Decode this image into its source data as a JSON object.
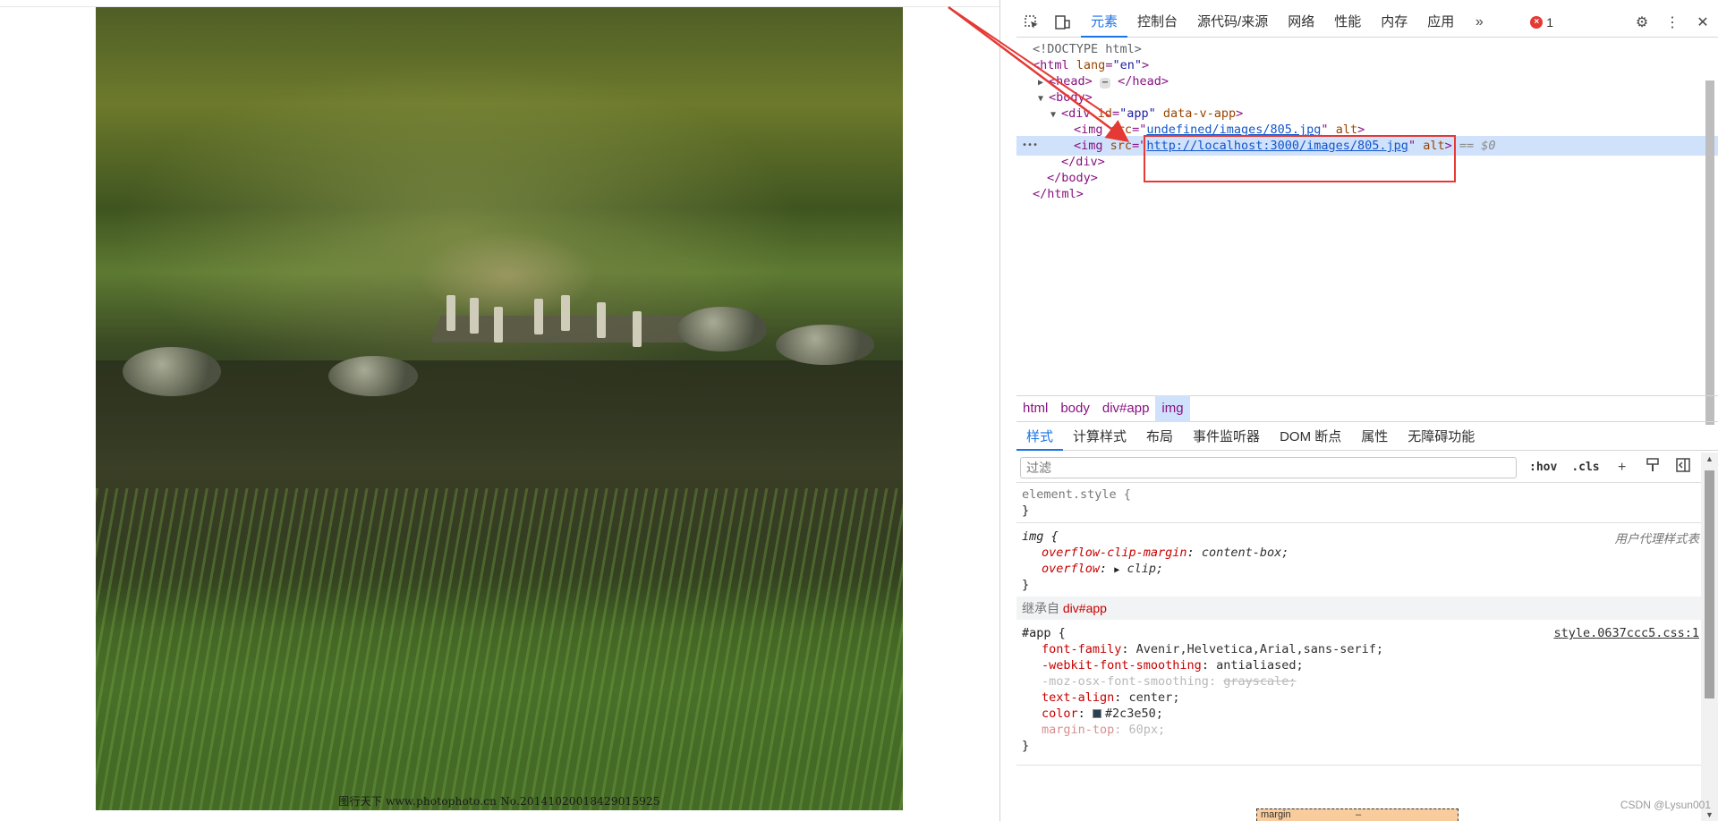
{
  "page": {
    "watermark": "图行天下 www.photophoto.cn No.20141020018429015925"
  },
  "devtools": {
    "tabs": [
      "元素",
      "控制台",
      "源代码/来源",
      "网络",
      "性能",
      "内存",
      "应用"
    ],
    "active_tab": "元素",
    "more_tabs_icon": "chevron-double-right-icon",
    "error_count": "1",
    "dom": {
      "doctype": "<!DOCTYPE html>",
      "html_open_tag": "html",
      "html_lang_attr": "lang",
      "html_lang_val": "\"en\"",
      "head_tag": "head",
      "head_close": "</head>",
      "body_tag": "body",
      "div_tag": "div",
      "div_id_attr": "id",
      "div_id_val": "\"app\"",
      "div_extra_attr": "data-v-app",
      "img1_tag": "img",
      "img1_src_attr": "src",
      "img1_src_val": "undefined/images/805.jpg",
      "img1_alt": "alt",
      "img2_tag": "img",
      "img2_src_attr": "src",
      "img2_src_val": "http://localhost:3000/images/805.jpg",
      "img2_alt": "alt",
      "selected_marker": "== $0",
      "div_close": "</div>",
      "body_close": "</body>",
      "html_close": "</html>",
      "gutter_dots": "•••"
    },
    "breadcrumbs": [
      "html",
      "body",
      "div#app",
      "img"
    ],
    "subtabs": [
      "样式",
      "计算样式",
      "布局",
      "事件监听器",
      "DOM 断点",
      "属性",
      "无障碍功能"
    ],
    "active_subtab": "样式",
    "filter": {
      "placeholder": "过滤",
      "hov_label": ":hov",
      "cls_label": ".cls"
    },
    "styles": {
      "element_style_selector": "element.style {",
      "close_brace": "}",
      "img_selector": "img {",
      "ua_label": "用户代理样式表",
      "img_props": [
        {
          "name": "overflow-clip-margin",
          "value": "content-box;"
        },
        {
          "name": "overflow",
          "value": "clip;"
        }
      ],
      "inherit_label": "继承自",
      "inherit_target": "div#app",
      "app_selector": "#app {",
      "app_source": "style.0637ccc5.css:1",
      "app_props": [
        {
          "name": "font-family",
          "value": "Avenir,Helvetica,Arial,sans-serif;"
        },
        {
          "name": "-webkit-font-smoothing",
          "value": "antialiased;"
        },
        {
          "name": "-moz-osx-font-smoothing",
          "value": "grayscale;"
        },
        {
          "name": "text-align",
          "value": "center;"
        },
        {
          "name": "color",
          "value": "#2c3e50;"
        },
        {
          "name": "margin-top",
          "value": "60px;"
        }
      ]
    },
    "boxmodel_label": "margin",
    "boxmodel_value": "–"
  },
  "footer_credit": "CSDN @Lysun001",
  "colors": {
    "accent": "#1a73e8",
    "annotation_red": "#e53935",
    "selected_row": "#cfe1fb",
    "swatch": "#2c3e50"
  }
}
